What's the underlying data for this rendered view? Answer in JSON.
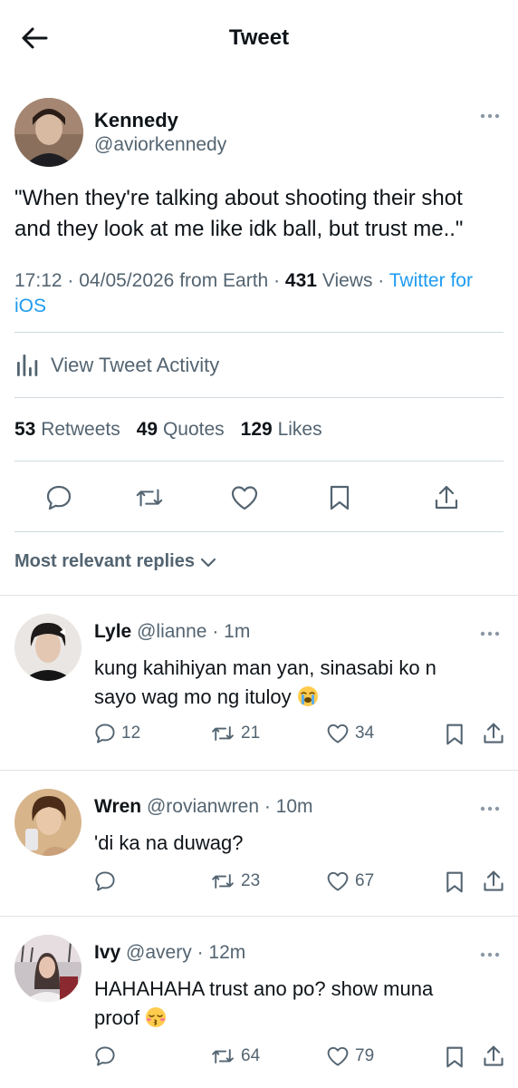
{
  "header": {
    "title": "Tweet"
  },
  "tweet": {
    "author_name": "Kennedy",
    "author_handle": "@aviorkennedy",
    "text": "\"When they're talking about shooting their shot and they look at me like idk ball, but trust me..\"",
    "time": "17:12",
    "date": "04/05/2026",
    "location": "from Earth",
    "views_count": "431",
    "views_label": "Views",
    "client_part1": "Twitter for",
    "client_part2": "iOS",
    "sep": "·"
  },
  "activity": {
    "label": "View Tweet Activity"
  },
  "stats": {
    "retweets_count": "53",
    "retweets_label": "Retweets",
    "quotes_count": "49",
    "quotes_label": "Quotes",
    "likes_count": "129",
    "likes_label": "Likes"
  },
  "replies_filter": {
    "label": "Most relevant replies"
  },
  "replies": [
    {
      "name": "Lyle",
      "handle": "@lianne",
      "time": "· 1m",
      "text_line1": "kung kahihiyan man yan, sinasabi ko n",
      "text_line2": "sayo wag mo ng ituloy",
      "emoji": "loudly-crying-face",
      "replies": "12",
      "retweets": "21",
      "likes": "34"
    },
    {
      "name": "Wren",
      "handle": "@rovianwren",
      "time": "· 10m",
      "text_line1": "'di ka na duwag?",
      "text_line2": "",
      "emoji": "",
      "replies": "",
      "retweets": "23",
      "likes": "67"
    },
    {
      "name": "Ivy",
      "handle": "@avery",
      "time": "· 12m",
      "text_line1": "HAHAHAHA trust ano po? show muna",
      "text_line2": "proof",
      "emoji": "kissing-closed-eyes-face",
      "replies": "",
      "retweets": "64",
      "likes": "79"
    }
  ],
  "colors": {
    "link": "#1d9bf0",
    "secondary": "#536471",
    "text": "#0f1419",
    "divider": "#cfd9de"
  }
}
